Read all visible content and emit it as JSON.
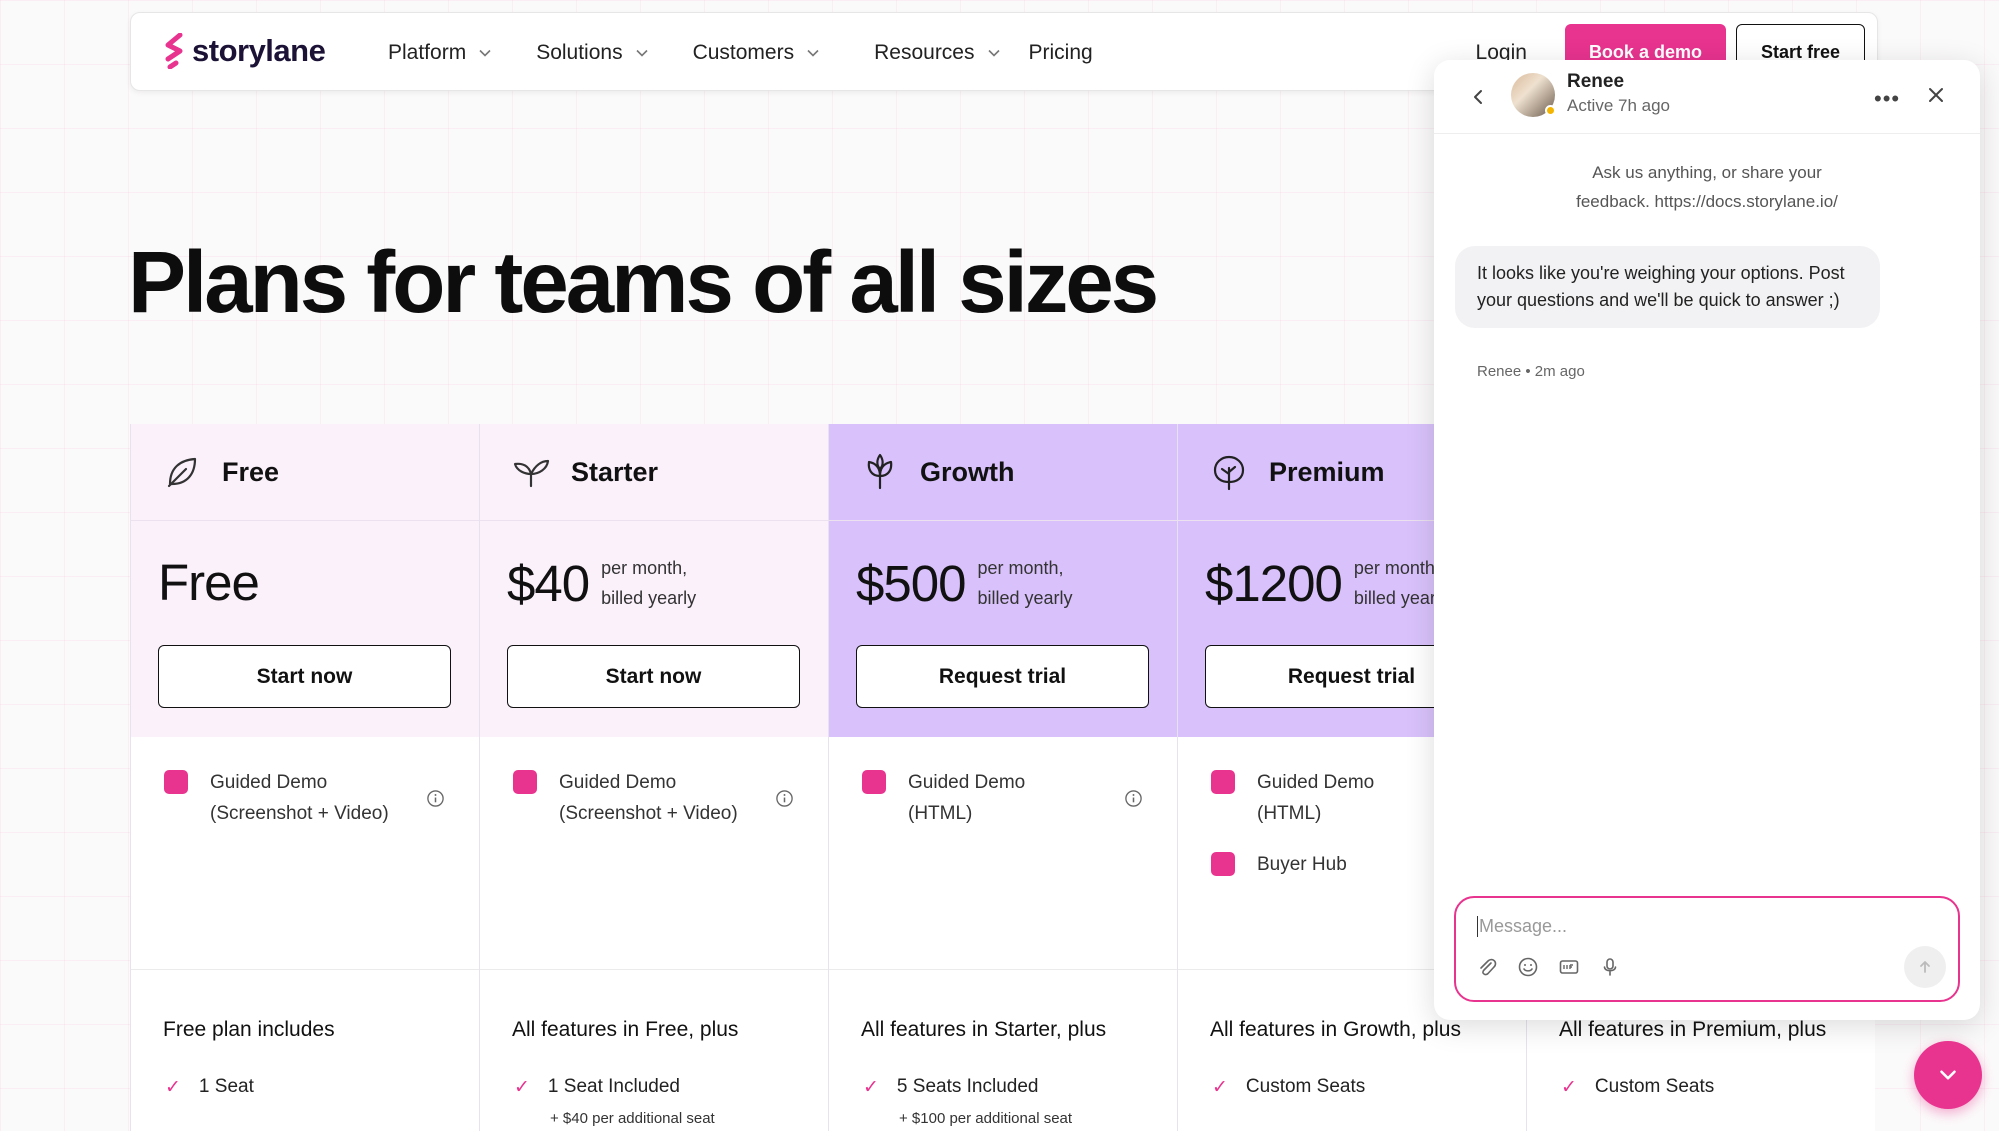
{
  "nav": {
    "logo": "storylane",
    "links": [
      {
        "label": "Platform",
        "dropdown": true
      },
      {
        "label": "Solutions",
        "dropdown": true
      },
      {
        "label": "Customers",
        "dropdown": true
      },
      {
        "label": "Resources",
        "dropdown": true
      },
      {
        "label": "Pricing",
        "dropdown": false
      }
    ],
    "login": "Login",
    "book_demo": "Book a demo",
    "start_free": "Start free"
  },
  "hero": {
    "title": "Plans for teams of all sizes"
  },
  "plans": [
    {
      "name": "Free",
      "icon": "leaf-icon",
      "price": "Free",
      "price_note_1": "",
      "price_note_2": "",
      "cta": "Start now",
      "feature_1_line_1": "Guided Demo",
      "feature_1_line_2": "(Screenshot + Video)",
      "includes_title": "Free plan includes",
      "includes_item": "1 Seat",
      "includes_sub": ""
    },
    {
      "name": "Starter",
      "icon": "sprout-icon",
      "price": "$40",
      "price_note_1": "per month,",
      "price_note_2": "billed yearly",
      "cta": "Start now",
      "feature_1_line_1": "Guided Demo",
      "feature_1_line_2": "(Screenshot + Video)",
      "includes_title": "All features in Free, plus",
      "includes_item": "1 Seat Included",
      "includes_sub": "+ $40 per additional seat"
    },
    {
      "name": "Growth",
      "icon": "plant-icon",
      "price": "$500",
      "price_note_1": "per month,",
      "price_note_2": "billed yearly",
      "cta": "Request trial",
      "feature_1_line_1": "Guided Demo",
      "feature_1_line_2": "(HTML)",
      "includes_title": "All features in Starter, plus",
      "includes_item": "5 Seats Included",
      "includes_sub": "+ $100 per additional seat"
    },
    {
      "name": "Premium",
      "icon": "tree-icon",
      "price": "$1200",
      "price_note_1": "per month",
      "price_note_2": "billed year",
      "cta": "Request trial",
      "feature_1_line_1": "Guided Demo",
      "feature_1_line_2": "(HTML)",
      "feature_2": "Buyer Hub",
      "includes_title": "All features in Growth, plus",
      "includes_item": "Custom Seats",
      "includes_sub": ""
    },
    {
      "includes_title": "All features in Premium, plus",
      "includes_item": "Custom Seats"
    }
  ],
  "chat": {
    "agent_name": "Renee",
    "agent_status": "Active 7h ago",
    "intro_line_1": "Ask us anything, or share your",
    "intro_line_2": "feedback. https://docs.storylane.io/",
    "message": "It looks like you're weighing your options. Post your questions and we'll be quick to answer ;)",
    "message_meta": "Renee • 2m ago",
    "input_placeholder": "Message..."
  },
  "colors": {
    "brand_pink": "#e8338f",
    "purple_tint": "#d9c2fb",
    "light_tint": "#fbf1fb"
  }
}
